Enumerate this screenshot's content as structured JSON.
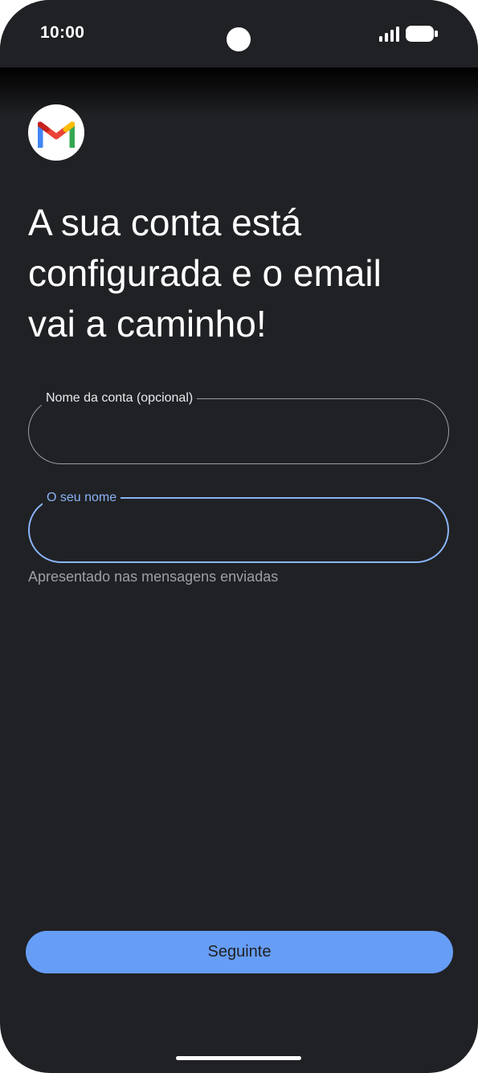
{
  "status_bar": {
    "time": "10:00",
    "icons": [
      "signal-icon",
      "battery-icon"
    ]
  },
  "app": {
    "logo_icon": "gmail-logo-icon",
    "headline": "A sua conta está\nconfigurada e o email\nvai a caminho!"
  },
  "form": {
    "account_name": {
      "label": "Nome da conta (opcional)",
      "value": ""
    },
    "your_name": {
      "label": "O seu nome",
      "value": "",
      "helper": "Apresentado nas mensagens enviadas"
    }
  },
  "actions": {
    "next_label": "Seguinte"
  },
  "colors": {
    "background": "#202124",
    "accent": "#8ab4f8",
    "button": "#669df6",
    "outline": "#9aa0a6"
  }
}
